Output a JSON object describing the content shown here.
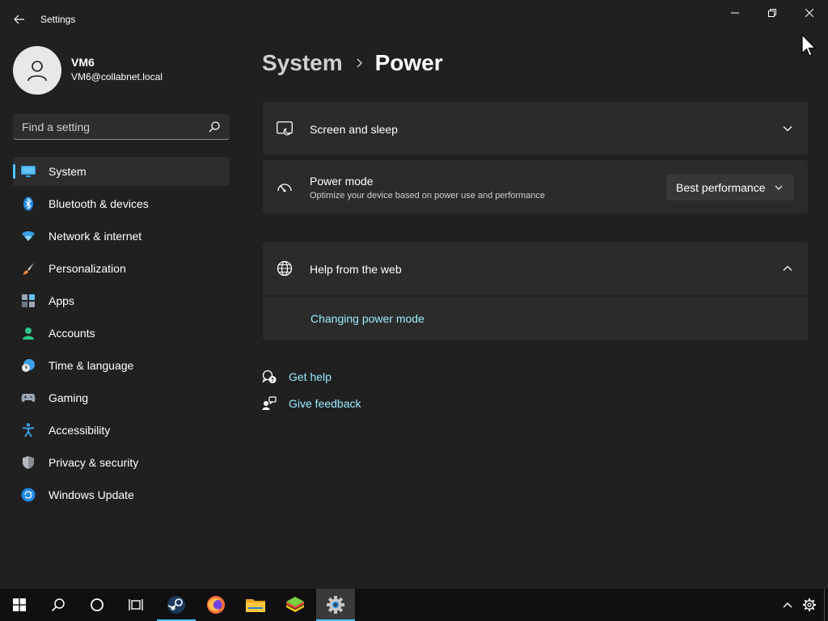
{
  "window": {
    "title": "Settings"
  },
  "profile": {
    "name": "VM6",
    "email": "VM6@collabnet.local"
  },
  "search": {
    "placeholder": "Find a setting"
  },
  "sidebar": {
    "items": [
      {
        "label": "System",
        "icon": "system-icon"
      },
      {
        "label": "Bluetooth & devices",
        "icon": "bluetooth-icon"
      },
      {
        "label": "Network & internet",
        "icon": "wifi-icon"
      },
      {
        "label": "Personalization",
        "icon": "brush-icon"
      },
      {
        "label": "Apps",
        "icon": "apps-icon"
      },
      {
        "label": "Accounts",
        "icon": "accounts-icon"
      },
      {
        "label": "Time & language",
        "icon": "clock-globe-icon"
      },
      {
        "label": "Gaming",
        "icon": "gamepad-icon"
      },
      {
        "label": "Accessibility",
        "icon": "accessibility-icon"
      },
      {
        "label": "Privacy & security",
        "icon": "shield-icon"
      },
      {
        "label": "Windows Update",
        "icon": "update-icon"
      }
    ],
    "selected_index": 0
  },
  "breadcrumb": {
    "parent": "System",
    "current": "Power"
  },
  "cards": {
    "screen_sleep": {
      "title": "Screen and sleep"
    },
    "power_mode": {
      "title": "Power mode",
      "subtitle": "Optimize your device based on power use and performance",
      "value": "Best performance"
    },
    "help_web": {
      "title": "Help from the web",
      "link": "Changing power mode"
    }
  },
  "footer": {
    "get_help": "Get help",
    "give_feedback": "Give feedback"
  },
  "colors": {
    "background": "#202020",
    "card": "#2b2b2b",
    "accent": "#4cc2ff",
    "link": "#99ebff"
  },
  "taskbar": {
    "apps": [
      "windows-start-icon",
      "search-icon",
      "cortana-icon",
      "task-view-icon",
      "steam-icon",
      "firefox-icon",
      "file-explorer-icon",
      "bluestacks-icon",
      "settings-icon"
    ]
  }
}
